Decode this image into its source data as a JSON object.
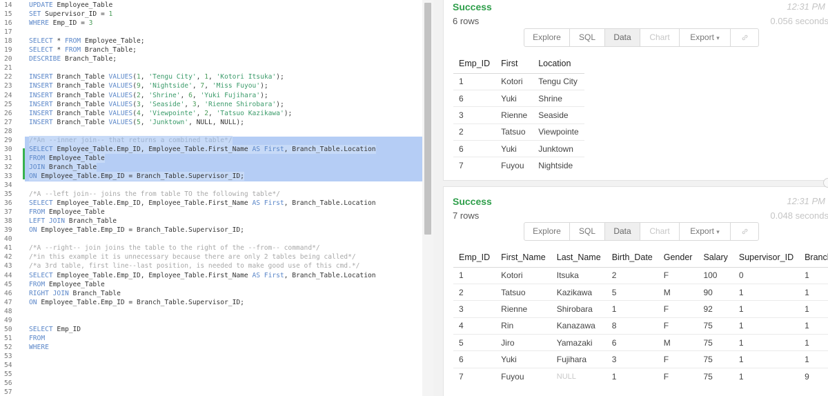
{
  "editor": {
    "lines": [
      {
        "n": "14",
        "t": [
          [
            "k",
            "UPDATE"
          ],
          [
            "p",
            " Employee_Table"
          ]
        ]
      },
      {
        "n": "15",
        "t": [
          [
            "k",
            "SET"
          ],
          [
            "p",
            " Supervisor_ID = "
          ],
          [
            "n",
            "1"
          ]
        ]
      },
      {
        "n": "16",
        "t": [
          [
            "k",
            "WHERE"
          ],
          [
            "p",
            " Emp_ID = "
          ],
          [
            "n",
            "3"
          ]
        ]
      },
      {
        "n": "17",
        "t": []
      },
      {
        "n": "18",
        "t": [
          [
            "k",
            "SELECT"
          ],
          [
            "p",
            " * "
          ],
          [
            "k",
            "FROM"
          ],
          [
            "p",
            " Employee_Table;"
          ]
        ]
      },
      {
        "n": "19",
        "t": [
          [
            "k",
            "SELECT"
          ],
          [
            "p",
            " * "
          ],
          [
            "k",
            "FROM"
          ],
          [
            "p",
            " Branch_Table;"
          ]
        ]
      },
      {
        "n": "20",
        "t": [
          [
            "k",
            "DESCRIBE"
          ],
          [
            "p",
            " Branch_Table;"
          ]
        ]
      },
      {
        "n": "21",
        "t": []
      },
      {
        "n": "22",
        "t": [
          [
            "k",
            "INSERT"
          ],
          [
            "p",
            " Branch_Table "
          ],
          [
            "k",
            "VALUES"
          ],
          [
            "p",
            "("
          ],
          [
            "n",
            "1"
          ],
          [
            "p",
            ", "
          ],
          [
            "s",
            "'Tengu City'"
          ],
          [
            "p",
            ", "
          ],
          [
            "n",
            "1"
          ],
          [
            "p",
            ", "
          ],
          [
            "s",
            "'Kotori Itsuka'"
          ],
          [
            "p",
            ");"
          ]
        ]
      },
      {
        "n": "23",
        "t": [
          [
            "k",
            "INSERT"
          ],
          [
            "p",
            " Branch_Table "
          ],
          [
            "k",
            "VALUES"
          ],
          [
            "p",
            "("
          ],
          [
            "n",
            "9"
          ],
          [
            "p",
            ", "
          ],
          [
            "s",
            "'Nightside'"
          ],
          [
            "p",
            ", "
          ],
          [
            "n",
            "7"
          ],
          [
            "p",
            ", "
          ],
          [
            "s",
            "'Miss Fuyou'"
          ],
          [
            "p",
            ");"
          ]
        ]
      },
      {
        "n": "24",
        "t": [
          [
            "k",
            "INSERT"
          ],
          [
            "p",
            " Branch_Table "
          ],
          [
            "k",
            "VALUES"
          ],
          [
            "p",
            "("
          ],
          [
            "n",
            "2"
          ],
          [
            "p",
            ", "
          ],
          [
            "s",
            "'Shrine'"
          ],
          [
            "p",
            ", "
          ],
          [
            "n",
            "6"
          ],
          [
            "p",
            ", "
          ],
          [
            "s",
            "'Yuki Fujihara'"
          ],
          [
            "p",
            ");"
          ]
        ]
      },
      {
        "n": "25",
        "t": [
          [
            "k",
            "INSERT"
          ],
          [
            "p",
            " Branch_Table "
          ],
          [
            "k",
            "VALUES"
          ],
          [
            "p",
            "("
          ],
          [
            "n",
            "3"
          ],
          [
            "p",
            ", "
          ],
          [
            "s",
            "'Seaside'"
          ],
          [
            "p",
            ", "
          ],
          [
            "n",
            "3"
          ],
          [
            "p",
            ", "
          ],
          [
            "s",
            "'Rienne Shirobara'"
          ],
          [
            "p",
            ");"
          ]
        ]
      },
      {
        "n": "26",
        "t": [
          [
            "k",
            "INSERT"
          ],
          [
            "p",
            " Branch_Table "
          ],
          [
            "k",
            "VALUES"
          ],
          [
            "p",
            "("
          ],
          [
            "n",
            "4"
          ],
          [
            "p",
            ", "
          ],
          [
            "s",
            "'Viewpointe'"
          ],
          [
            "p",
            ", "
          ],
          [
            "n",
            "2"
          ],
          [
            "p",
            ", "
          ],
          [
            "s",
            "'Tatsuo Kazikawa'"
          ],
          [
            "p",
            ");"
          ]
        ]
      },
      {
        "n": "27",
        "t": [
          [
            "k",
            "INSERT"
          ],
          [
            "p",
            " Branch_Table "
          ],
          [
            "k",
            "VALUES"
          ],
          [
            "p",
            "("
          ],
          [
            "n",
            "5"
          ],
          [
            "p",
            ", "
          ],
          [
            "s",
            "'Junktown'"
          ],
          [
            "p",
            ", NULL, NULL);"
          ]
        ]
      },
      {
        "n": "28",
        "t": []
      },
      {
        "n": "29",
        "t": [
          [
            "c",
            "/*An --inner join-- that returns a combined table*/"
          ]
        ],
        "sel": true
      },
      {
        "n": "30",
        "t": [
          [
            "k",
            "SELECT"
          ],
          [
            "p",
            " Employee_Table.Emp_ID, Employee_Table.First_Name "
          ],
          [
            "k",
            "AS"
          ],
          [
            "k",
            " First"
          ],
          [
            "p",
            ", Branch_Table.Location"
          ]
        ],
        "sel": true
      },
      {
        "n": "31",
        "t": [
          [
            "k",
            "FROM"
          ],
          [
            "p",
            " Employee_Table"
          ]
        ],
        "sel": true
      },
      {
        "n": "32",
        "t": [
          [
            "k",
            "JOIN"
          ],
          [
            "p",
            " Branch_Table"
          ]
        ],
        "sel": true
      },
      {
        "n": "33",
        "t": [
          [
            "k",
            "ON"
          ],
          [
            "p",
            " Employee_Table.Emp_ID = Branch_Table.Supervisor_ID;"
          ]
        ],
        "sel": true
      },
      {
        "n": "34",
        "t": []
      },
      {
        "n": "35",
        "t": [
          [
            "c",
            "/*A --left join-- joins the from table TO the following table*/"
          ]
        ]
      },
      {
        "n": "36",
        "t": [
          [
            "k",
            "SELECT"
          ],
          [
            "p",
            " Employee_Table.Emp_ID, Employee_Table.First_Name "
          ],
          [
            "k",
            "AS"
          ],
          [
            "k",
            " First"
          ],
          [
            "p",
            ", Branch_Table.Location"
          ]
        ]
      },
      {
        "n": "37",
        "t": [
          [
            "k",
            "FROM"
          ],
          [
            "p",
            " Employee_Table"
          ]
        ]
      },
      {
        "n": "38",
        "t": [
          [
            "k",
            "LEFT JOIN"
          ],
          [
            "p",
            " Branch_Table"
          ]
        ]
      },
      {
        "n": "39",
        "t": [
          [
            "k",
            "ON"
          ],
          [
            "p",
            " Employee_Table.Emp_ID = Branch_Table.Supervisor_ID;"
          ]
        ]
      },
      {
        "n": "40",
        "t": []
      },
      {
        "n": "41",
        "t": [
          [
            "c",
            "/*A --right-- join joins the table to the right of the --from-- command*/"
          ]
        ]
      },
      {
        "n": "42",
        "t": [
          [
            "c",
            "/*in this example it is unnecessary because there are only 2 tables being called*/"
          ]
        ]
      },
      {
        "n": "43",
        "t": [
          [
            "c",
            "/*a 3rd table, first line--last position, is needed to make good use of this cmd.*/"
          ]
        ]
      },
      {
        "n": "44",
        "t": [
          [
            "k",
            "SELECT"
          ],
          [
            "p",
            " Employee_Table.Emp_ID, Employee_Table.First_Name "
          ],
          [
            "k",
            "AS"
          ],
          [
            "k",
            " First"
          ],
          [
            "p",
            ", Branch_Table.Location"
          ]
        ]
      },
      {
        "n": "45",
        "t": [
          [
            "k",
            "FROM"
          ],
          [
            "p",
            " Employee_Table"
          ]
        ]
      },
      {
        "n": "46",
        "t": [
          [
            "k",
            "RIGHT JOIN"
          ],
          [
            "p",
            " Branch_Table"
          ]
        ]
      },
      {
        "n": "47",
        "t": [
          [
            "k",
            "ON"
          ],
          [
            "p",
            " Employee_Table.Emp_ID = Branch_Table.Supervisor_ID;"
          ]
        ]
      },
      {
        "n": "48",
        "t": []
      },
      {
        "n": "49",
        "t": []
      },
      {
        "n": "50",
        "t": [
          [
            "k",
            "SELECT"
          ],
          [
            "p",
            " Emp_ID"
          ]
        ]
      },
      {
        "n": "51",
        "t": [
          [
            "k",
            "FROM"
          ]
        ]
      },
      {
        "n": "52",
        "t": [
          [
            "k",
            "WHERE"
          ]
        ]
      },
      {
        "n": "53",
        "t": []
      },
      {
        "n": "54",
        "t": []
      },
      {
        "n": "55",
        "t": []
      },
      {
        "n": "56",
        "t": []
      },
      {
        "n": "57",
        "t": []
      }
    ]
  },
  "toolbar_labels": {
    "explore": "Explore",
    "sql": "SQL",
    "data": "Data",
    "chart": "Chart",
    "export": "Export",
    "export_caret": "▾",
    "link_icon": "link-icon"
  },
  "results": [
    {
      "status": "Success",
      "rows_label": "6 rows",
      "time": "12:31 PM",
      "duration": "0.056 seconds",
      "columns": [
        "Emp_ID",
        "First",
        "Location"
      ],
      "rows": [
        [
          "1",
          "Kotori",
          "Tengu City"
        ],
        [
          "6",
          "Yuki",
          "Shrine"
        ],
        [
          "3",
          "Rienne",
          "Seaside"
        ],
        [
          "2",
          "Tatsuo",
          "Viewpointe"
        ],
        [
          "6",
          "Yuki",
          "Junktown"
        ],
        [
          "7",
          "Fuyou",
          "Nightside"
        ]
      ]
    },
    {
      "status": "Success",
      "rows_label": "7 rows",
      "time": "12:31 PM",
      "duration": "0.048 seconds",
      "columns": [
        "Emp_ID",
        "First_Name",
        "Last_Name",
        "Birth_Date",
        "Gender",
        "Salary",
        "Supervisor_ID",
        "Branch_ID"
      ],
      "rows": [
        [
          "1",
          "Kotori",
          "Itsuka",
          "2",
          "F",
          "100",
          "0",
          "1"
        ],
        [
          "2",
          "Tatsuo",
          "Kazikawa",
          "5",
          "M",
          "90",
          "1",
          "1"
        ],
        [
          "3",
          "Rienne",
          "Shirobara",
          "1",
          "F",
          "92",
          "1",
          "1"
        ],
        [
          "4",
          "Rin",
          "Kanazawa",
          "8",
          "F",
          "75",
          "1",
          "1"
        ],
        [
          "5",
          "Jiro",
          "Yamazaki",
          "6",
          "M",
          "75",
          "1",
          "1"
        ],
        [
          "6",
          "Yuki",
          "Fujihara",
          "3",
          "F",
          "75",
          "1",
          "1"
        ],
        [
          "7",
          "Fuyou",
          "NULL",
          "1",
          "F",
          "75",
          "1",
          "9"
        ]
      ]
    }
  ]
}
